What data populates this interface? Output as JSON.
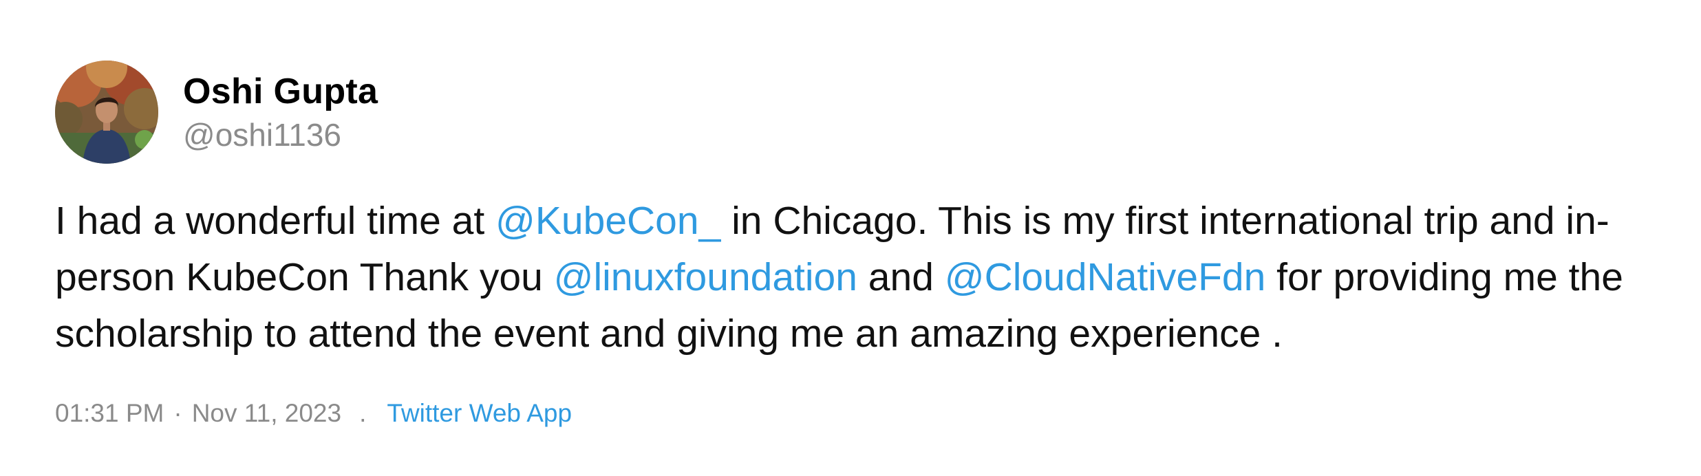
{
  "author": {
    "display_name": "Oshi Gupta",
    "handle": "@oshi1136",
    "avatar_icon": "profile-photo"
  },
  "tweet": {
    "segments": [
      {
        "text": "I had a wonderful time at ",
        "type": "text"
      },
      {
        "text": "@KubeCon_",
        "type": "mention"
      },
      {
        "text": " in Chicago. This is my first international trip and in-person KubeCon Thank you ",
        "type": "text"
      },
      {
        "text": "@linuxfoundation",
        "type": "mention"
      },
      {
        "text": " and ",
        "type": "text"
      },
      {
        "text": "@CloudNativeFdn",
        "type": "mention"
      },
      {
        "text": " for providing me the scholarship to attend the event and giving me an amazing experience .",
        "type": "text"
      }
    ]
  },
  "meta": {
    "time": "01:31 PM",
    "dot": "·",
    "date": "Nov 11, 2023",
    "separator": ".",
    "source": "Twitter Web App"
  },
  "colors": {
    "link": "#2f9ae0",
    "secondary": "#8a8a8a",
    "text": "#111111"
  }
}
